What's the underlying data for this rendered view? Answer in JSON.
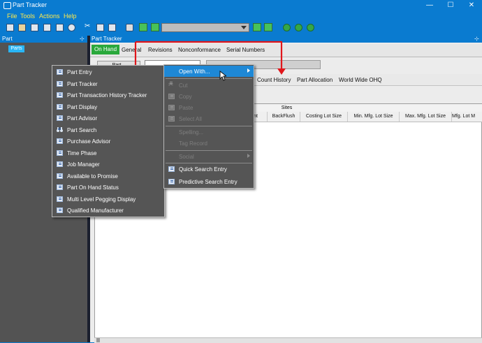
{
  "window": {
    "title": "Part Tracker",
    "controls": [
      "—",
      "☐",
      "✕"
    ]
  },
  "menu": [
    "File",
    "Tools",
    "Actions",
    "Help"
  ],
  "left_panel": {
    "header": "Part",
    "pin": "⊹",
    "tree_item": "Parts"
  },
  "main_panel": {
    "header": "Part Tracker",
    "pin": "⊹",
    "tabs": [
      "On Hand",
      "General",
      "Revisions",
      "Nonconformance",
      "Serial Numbers"
    ],
    "part_label": "Part...",
    "subtabs": [
      "Count History",
      "Part Allocation",
      "World Wide OHQ"
    ],
    "grid": {
      "group_header": "Sites",
      "columns": [
        "Point",
        "BackFlush",
        "Costing Lot Size",
        "Min. Mfg. Lot Size",
        "Max. Mfg. Lot Size",
        "Mfg. Lot M"
      ]
    }
  },
  "context_menu": {
    "items": [
      "Part Entry",
      "Part Tracker",
      "Part Transaction History Tracker",
      "Part Display",
      "Part Advisor",
      "Part Search",
      "Purchase Advisor",
      "Time Phase",
      "Job Manager",
      "Available to Promise",
      "Part On Hand Status",
      "Multi Level Pegging Display",
      "Qualified Manufacturer"
    ]
  },
  "edit_menu": {
    "open_with": "Open With...",
    "cut": "Cut",
    "copy": "Copy",
    "paste": "Paste",
    "select_all": "Select All",
    "spelling": "Spelling...",
    "tag_record": "Tag Record",
    "social": "Social",
    "quick_search": "Quick Search Entry",
    "predictive_search": "Predictive Search Entry"
  },
  "colors": {
    "accent": "#0a7bd0",
    "menu_text": "#ffe94a",
    "active_tab": "#29a83b",
    "annotation_arrow": "#e0161b",
    "context_bg": "#555555",
    "highlight": "#1e88d6"
  }
}
